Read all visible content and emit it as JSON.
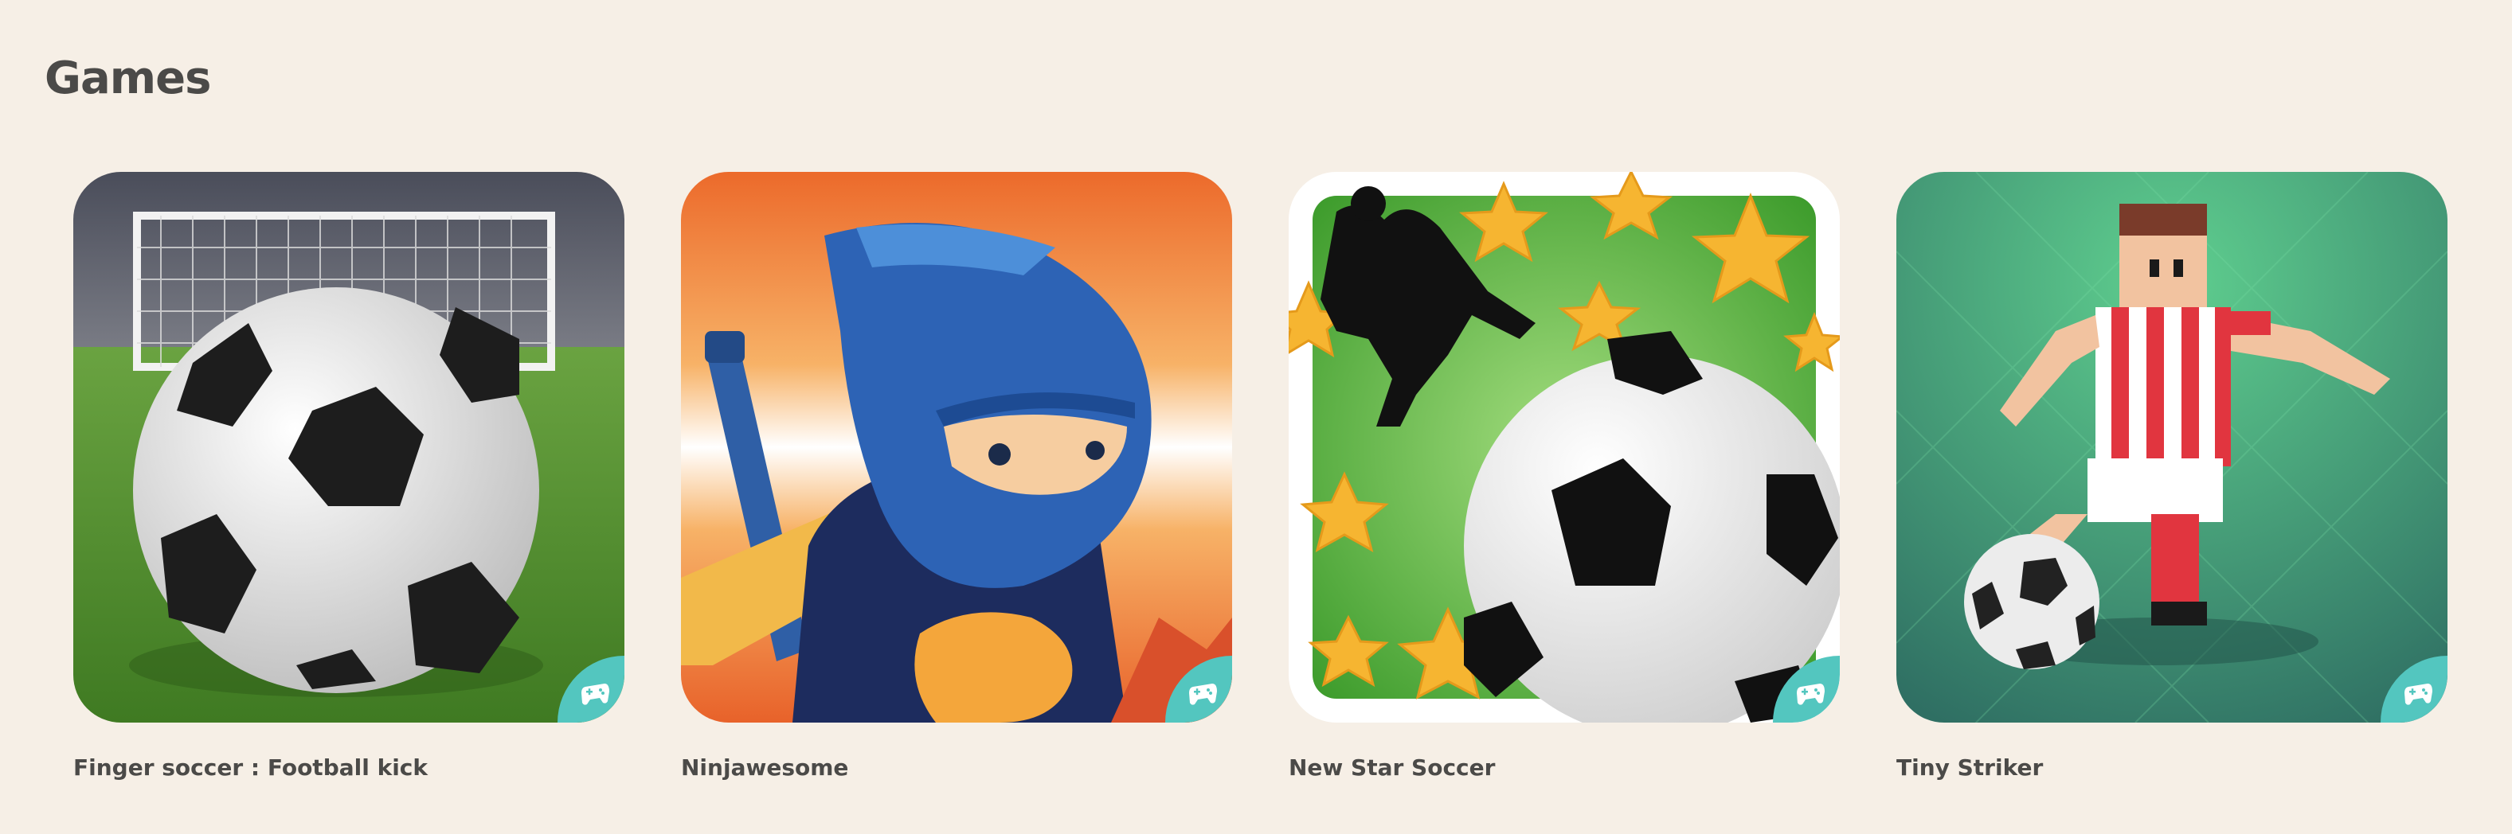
{
  "section": {
    "title": "Games"
  },
  "games": [
    {
      "name": "Finger soccer : Football kick",
      "badge_icon": "gamepad-icon"
    },
    {
      "name": "Ninjawesome",
      "badge_icon": "gamepad-icon"
    },
    {
      "name": "New Star Soccer",
      "badge_icon": "gamepad-icon"
    },
    {
      "name": "Tiny Striker",
      "badge_icon": "gamepad-icon"
    }
  ],
  "colors": {
    "background": "#f6efe6",
    "text": "#4b4a48",
    "badge": "#53c6bf"
  }
}
